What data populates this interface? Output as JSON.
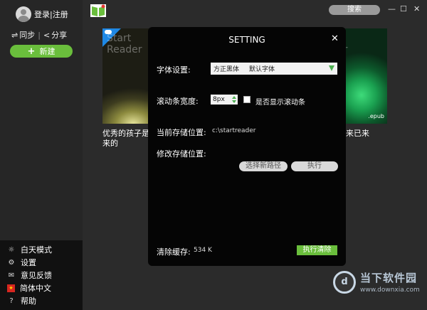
{
  "sidebar": {
    "login_label": "登录|注册",
    "sync_label": "同步",
    "share_label": "分享",
    "new_label": "新建",
    "bottom_items": [
      {
        "icon": "sun-icon",
        "label": "白天模式"
      },
      {
        "icon": "gear-icon",
        "label": "设置"
      },
      {
        "icon": "mail-icon",
        "label": "意见反馈"
      },
      {
        "icon": "china-flag-icon",
        "label": "简体中文"
      },
      {
        "icon": "help-icon",
        "label": "帮助"
      }
    ]
  },
  "header": {
    "search_label": "搜索",
    "minimize": "—",
    "maximize": "☐",
    "close": "✕"
  },
  "books": [
    {
      "cover_text": "Start\nReader",
      "title": "优秀的孩子是\n来的"
    },
    {
      "cover_text": "er",
      "format": ".epub",
      "title": "来已来"
    }
  ],
  "dialog": {
    "title": "SETTING",
    "close": "✕",
    "font_label": "字体设置:",
    "font_value": "方正黑体",
    "font_default": "默认字体",
    "scrollbar_label": "滚动条宽度:",
    "scrollbar_value": "8px",
    "show_scrollbar_label": "是否显示滚动条",
    "current_path_label": "当前存储位置:",
    "current_path_value": "c:\\startreader",
    "change_path_label": "修改存储位置:",
    "choose_path_button": "选择新路径",
    "execute_button": "执行",
    "cache_label": "清除缓存:",
    "cache_value": "534 K",
    "clear_button": "执行清除"
  },
  "watermark": {
    "name": "当下软件园",
    "url": "www.downxia.com"
  },
  "colors": {
    "accent": "#6abe3c",
    "dialog_bg": "#050505",
    "sidebar_bg": "#262626"
  }
}
